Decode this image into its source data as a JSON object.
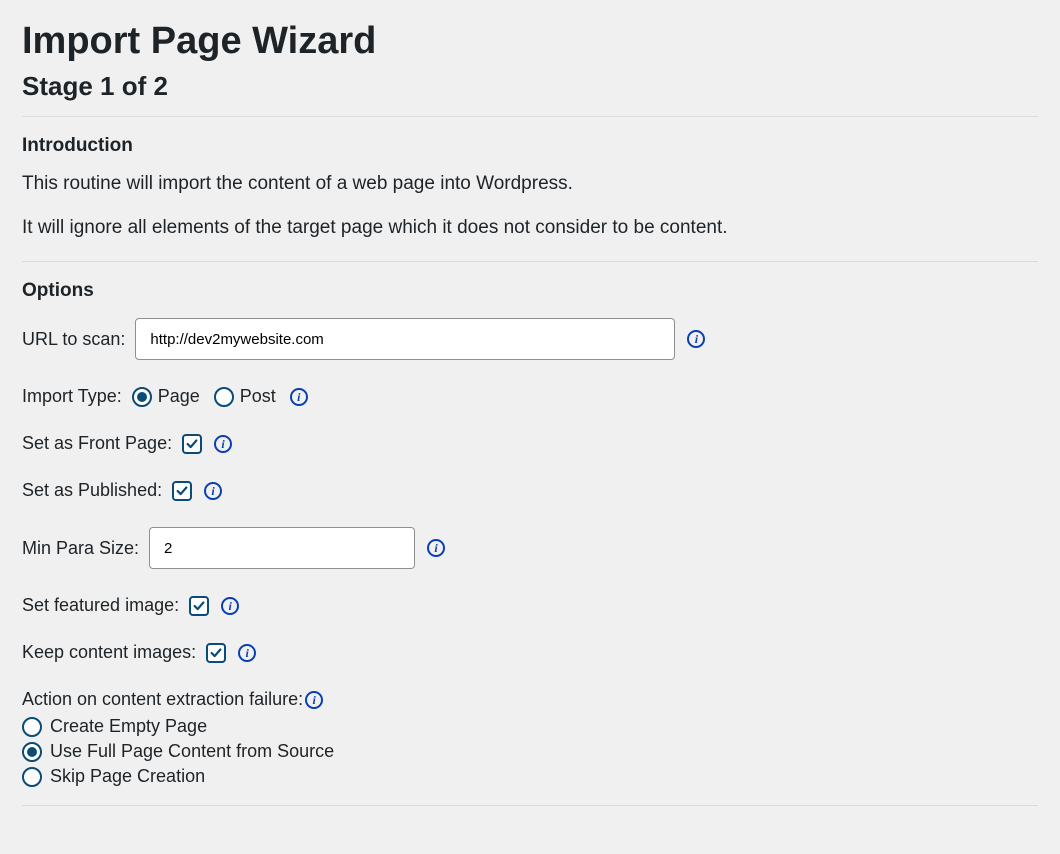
{
  "header": {
    "title": "Import Page Wizard",
    "stage": "Stage 1 of 2"
  },
  "intro": {
    "heading": "Introduction",
    "line1": "This routine will import the content of a web page into Wordpress.",
    "line2": "It will ignore all elements of the target page which it does not consider to be content."
  },
  "options": {
    "heading": "Options",
    "url": {
      "label": "URL to scan:",
      "value": "http://dev2mywebsite.com"
    },
    "import_type": {
      "label": "Import Type:",
      "page": "Page",
      "post": "Post",
      "selected": "page"
    },
    "front_page": {
      "label": "Set as Front Page:",
      "checked": true
    },
    "published": {
      "label": "Set as Published:",
      "checked": true
    },
    "min_para": {
      "label": "Min Para Size:",
      "value": "2"
    },
    "featured_image": {
      "label": "Set featured image:",
      "checked": true
    },
    "keep_images": {
      "label": "Keep content images:",
      "checked": true
    },
    "failure_action": {
      "label": "Action on content extraction failure:",
      "selected": "full",
      "opts": {
        "empty": "Create Empty Page",
        "full": "Use Full Page Content from Source",
        "skip": "Skip Page Creation"
      }
    }
  }
}
